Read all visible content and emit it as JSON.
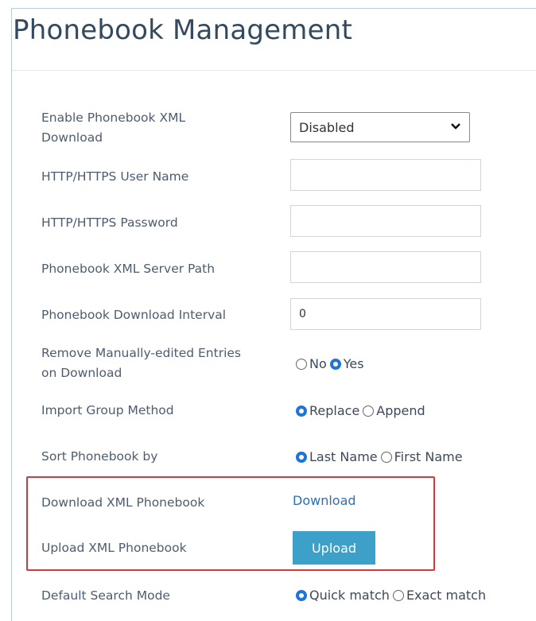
{
  "title": "Phonebook Management",
  "fields": {
    "enable_xml_download": {
      "label_line1": "Enable Phonebook XML",
      "label_line2": "Download",
      "value": "Disabled"
    },
    "http_user": {
      "label": "HTTP/HTTPS User Name",
      "value": ""
    },
    "http_password": {
      "label": "HTTP/HTTPS Password",
      "value": ""
    },
    "xml_server_path": {
      "label": "Phonebook XML Server Path",
      "value": ""
    },
    "download_interval": {
      "label": "Phonebook Download Interval",
      "value": "0"
    },
    "remove_manual": {
      "label_line1": "Remove Manually-edited Entries",
      "label_line2": "on Download",
      "options": [
        "No",
        "Yes"
      ],
      "selected": "Yes"
    },
    "import_group": {
      "label": "Import Group Method",
      "options": [
        "Replace",
        "Append"
      ],
      "selected": "Replace"
    },
    "sort_by": {
      "label": "Sort Phonebook by",
      "options": [
        "Last Name",
        "First Name"
      ],
      "selected": "Last Name"
    },
    "download_xml": {
      "label": "Download XML Phonebook",
      "link": "Download"
    },
    "upload_xml": {
      "label": "Upload XML Phonebook",
      "button": "Upload"
    },
    "search_mode": {
      "label": "Default Search Mode",
      "options": [
        "Quick match",
        "Exact match"
      ],
      "selected": "Quick match"
    }
  },
  "colors": {
    "accent": "#3da0c9",
    "link": "#2b6fb5",
    "highlight_border": "#d9383a",
    "radio_selected": "#1e74d8"
  }
}
